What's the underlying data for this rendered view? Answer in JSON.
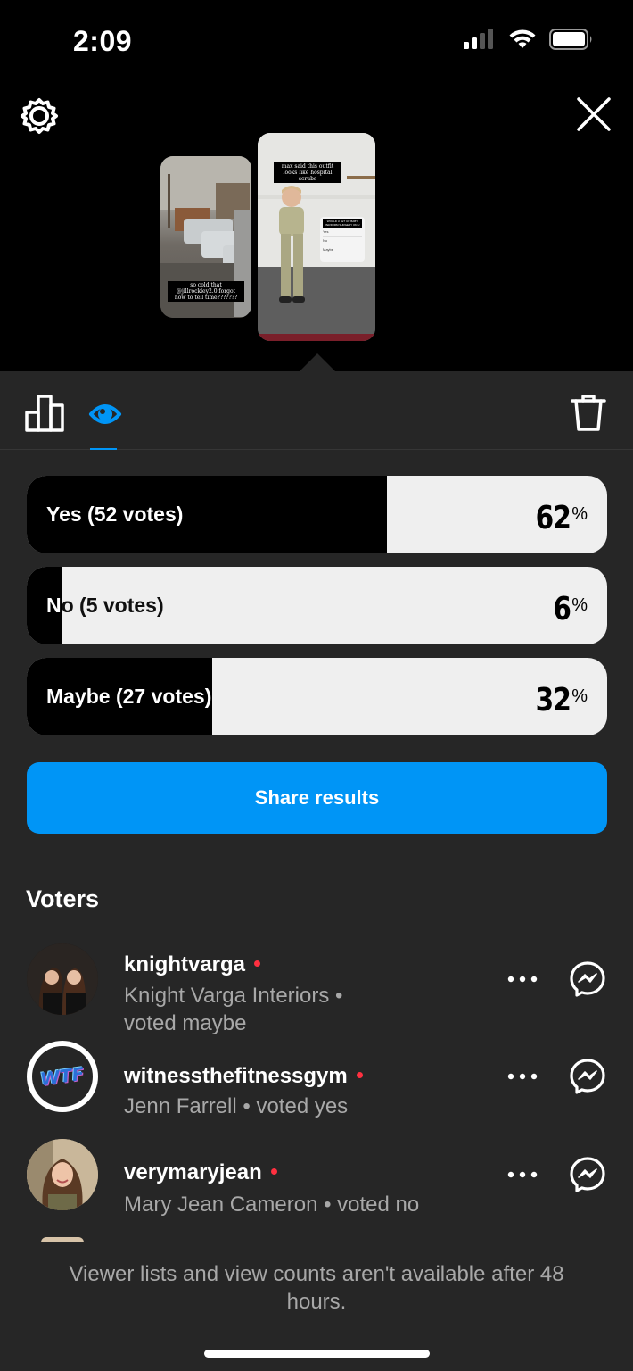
{
  "status": {
    "time": "2:09"
  },
  "stories": {
    "left_caption": "so cold that @jillrockley2.0 forgot how to tell time???????",
    "right_caption": "max said this outfit looks like hospital scrubs",
    "right_poll_title": "WOULD U LET UR BABY PERFORM SURGERY ON U",
    "right_poll_options": [
      "Yes",
      "No",
      "Maybe"
    ]
  },
  "poll": {
    "options": [
      {
        "label": "Yes (52 votes)",
        "percent": 62,
        "pct_text": "62",
        "symbol": "%"
      },
      {
        "label": "No (5 votes)",
        "percent": 6,
        "pct_text": "6",
        "symbol": "%"
      },
      {
        "label": "Maybe (27 votes)",
        "percent": 32,
        "pct_text": "32",
        "symbol": "%"
      }
    ],
    "share_label": "Share results"
  },
  "voters_title": "Voters",
  "voters": [
    {
      "username": "knightvarga",
      "subtitle_line1": "Knight Varga Interiors •",
      "subtitle_line2": "voted maybe"
    },
    {
      "username": "witnessthefitnessgym",
      "subtitle_line1": "Jenn Farrell • voted yes",
      "avatar_text": "WTF"
    },
    {
      "username": "verymaryjean",
      "subtitle_line1": "Mary Jean Cameron • voted no"
    }
  ],
  "footer_text": "Viewer lists and view counts aren't available after 48 hours.",
  "colors": {
    "accent": "#0095f6",
    "panel": "#262626",
    "unread_dot": "#ff3040"
  }
}
